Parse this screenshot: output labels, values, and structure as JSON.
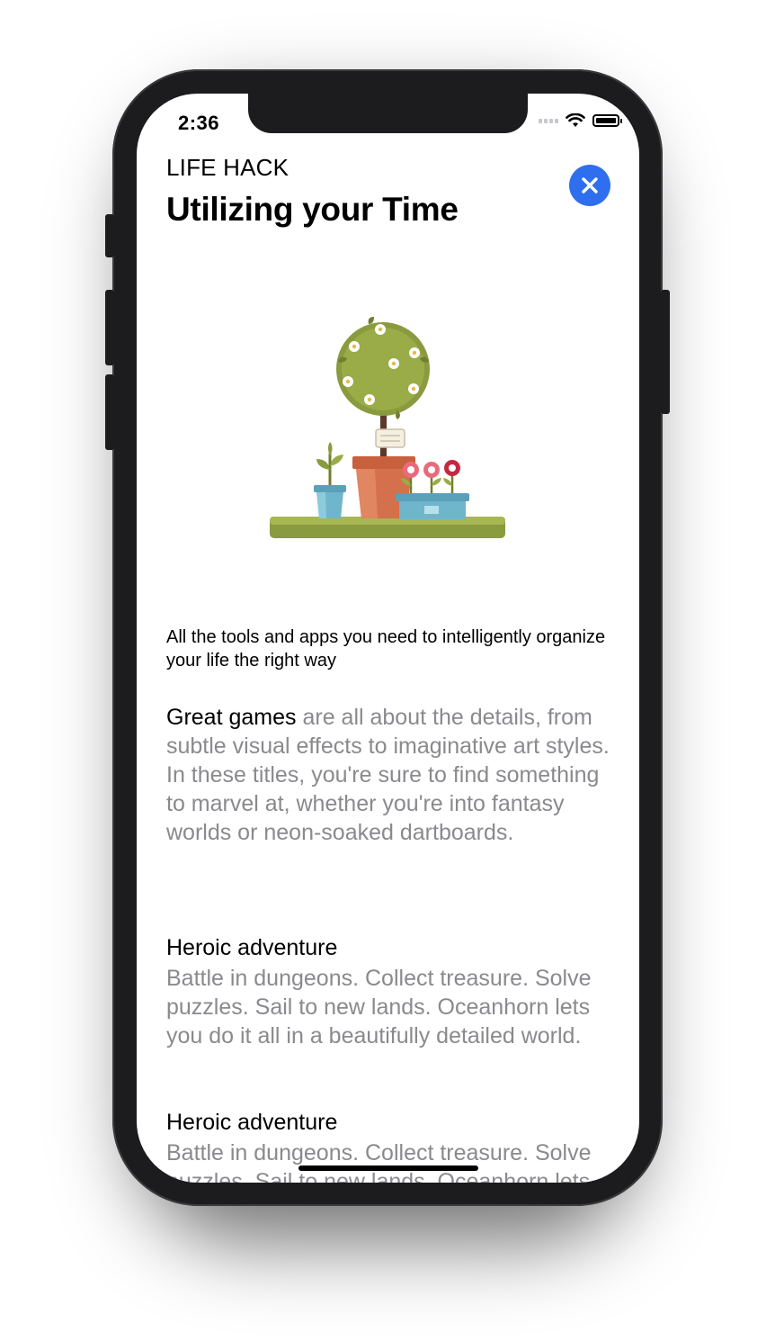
{
  "status_bar": {
    "time": "2:36"
  },
  "article": {
    "category": "LIFE HACK",
    "title": "Utilizing your Time",
    "hero_image": "potted-plants-illustration",
    "subtitle": "All the tools and apps you need to intelligently organize your life the right way",
    "intro_highlight": "Great games",
    "intro_rest": " are all about the details, from subtle visual effects to imaginative art styles. In these titles, you're sure to find something to marvel at, whether you're into fantasy worlds or neon-soaked dartboards.",
    "sections": [
      {
        "heading": "Heroic adventure",
        "body": "Battle in dungeons. Collect treasure. Solve puzzles. Sail to new lands. Oceanhorn lets you do it all in a beautifully detailed world."
      },
      {
        "heading": "Heroic adventure",
        "body": "Battle in dungeons. Collect treasure. Solve puzzles. Sail to new lands. Oceanhorn lets you do it all in a beautifully detailed world."
      }
    ]
  },
  "icons": {
    "close": "close-icon",
    "wifi": "wifi-icon",
    "battery": "battery-icon",
    "signal": "cellular-signal-icon"
  },
  "colors": {
    "close_button": "#2f6fef",
    "body_text_secondary": "#8a8a8e",
    "device_frame": "#1c1c1e"
  }
}
